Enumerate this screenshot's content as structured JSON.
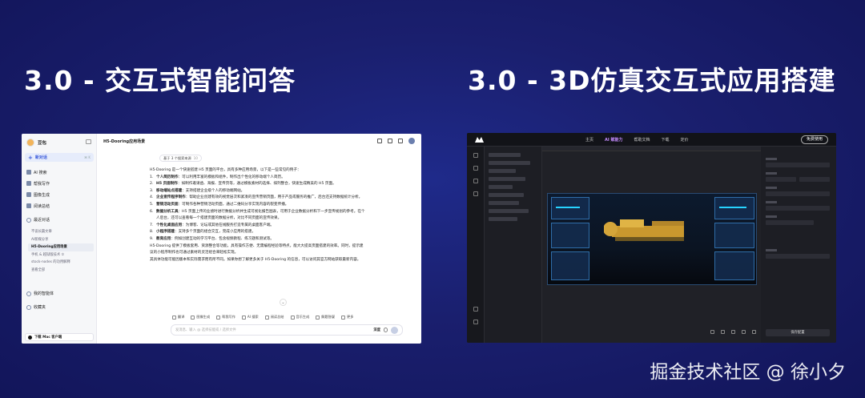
{
  "slide": {
    "title_left": "3.0 - 交互式智能问答",
    "title_right": "3.0 - 3D仿真交互式应用搭建",
    "watermark": "掘金技术社区 @ 徐小夕",
    "background_color": "#1a1f6e"
  },
  "chat_app": {
    "brand": "豆包",
    "new_chat": "新对话",
    "new_chat_shortcut": "⌘ K",
    "nav_items": [
      "AI 搜索",
      "帮我写作",
      "图像生成",
      "阅读总结"
    ],
    "recent_label": "最近对话",
    "history": [
      "不谈长篇文章",
      "AI新媒分享",
      "H5-Dooring应用场景",
      "手机 & 越狱版技术 ①",
      "stock-nodes 的功用解释",
      "查看全部"
    ],
    "my_agents_label": "我的智能体",
    "favorites_label": "收藏夹",
    "download_label": "下载 Mac 客户端",
    "topbar_title": "H5-Dooring应用场景",
    "search_chip": "基于 3 个搜索来源",
    "search_chip_count": "10",
    "intro": "H5-Dooring 是一个快速搭建 H5 页面的平台，具有多种应用场景，以下是一些常见的例子：",
    "items": [
      {
        "num": "1.",
        "title": "个人简历制作",
        "text": "：可以利用丰富的模板和组件，制作出个性化的移动端个人简历。"
      },
      {
        "num": "2.",
        "title": "H5 页面制作",
        "text": "：如制作邀请函、海报、宣传页等，通过模板素材的选择、排列整合，快速生成精美的 H5 页面。"
      },
      {
        "num": "3.",
        "title": "移动端站点搭建",
        "text": "：支持搭建企业级个人的移动端网站。"
      },
      {
        "num": "4.",
        "title": "企业宣传程序制作",
        "text": "：帮助企业创建有效的视觉层次和紧凑的宣传营销页面，用于产品或服务的推广，后台还支持数据统计分析。"
      },
      {
        "num": "5.",
        "title": "营销活动页面",
        "text": "：可制作各种营销活动页面，通过二维码分享实现内容的裂变传播。"
      },
      {
        "num": "6.",
        "title": "数据分析工具",
        "text": "：H5 页面上传的业绩时进行数据分析并生成可视化报告图表，可用于企业数据分析和下一步宣传规划的参考。在个人后台，还可以查看每一个搭建页面的数据分析，对比不同页面的宣传效果。"
      },
      {
        "num": "7.",
        "title": "个性化桌面应用",
        "text": "：为博客、论坛或其他在线服务打造专属的桌面客户端。"
      },
      {
        "num": "8.",
        "title": "小程序搭建",
        "text": "：支持多个页面的组合交互，完成小应用的搭建。"
      },
      {
        "num": "9.",
        "title": "教育应用",
        "text": "：例如创建互动的学习平台、包含视频教程、练习题和测试等。"
      }
    ],
    "outro": "H5-Dooring 提供了模板套用、资源整合等功能，具有操作方便、无需编程经验等特点，能大大提高页面搭建的效率。同时，提示建议的小程序制作也可通过素材的灵活组合来轻松实现。",
    "footnote": "其具体功能可能因版本和实际需求而有所不同。如果你想了解更多关于 H5-Dooring 的信息，可以访问其官方网站获取最新内容。",
    "tools": [
      "翻译",
      "图像生成",
      "帮我写作",
      "AI 搜索",
      "阅读总结",
      "音乐生成",
      "解题答疑",
      "更多"
    ],
    "input_placeholder": "发消息、输入 @ 选择技能或 / 选择文件",
    "input_tag": "深度"
  },
  "editor_3d": {
    "menu": [
      "主页",
      "AI 赋能力",
      "帮助文档",
      "下载",
      "定价"
    ],
    "active_menu": "AI 赋能力",
    "cta": "免费使用",
    "panel_button": "保存配置",
    "accent_color": "#27d3ff"
  }
}
